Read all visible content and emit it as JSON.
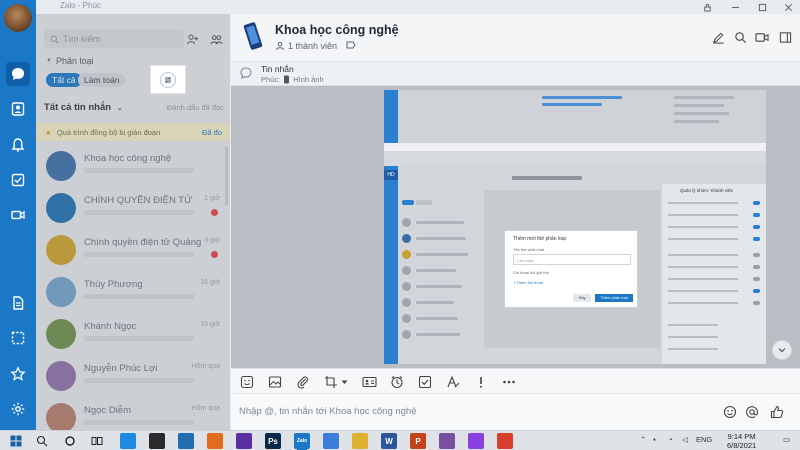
{
  "window": {
    "title": "Zalo - Phúc",
    "controls": [
      "lock-icon",
      "minimize-icon",
      "maximize-icon",
      "close-icon"
    ]
  },
  "sidebar": {
    "items": [
      {
        "name": "messages",
        "icon": "chat-bubble-icon",
        "active": true
      },
      {
        "name": "contacts",
        "icon": "contacts-icon",
        "active": false
      },
      {
        "name": "notifications",
        "icon": "bell-icon",
        "active": false
      },
      {
        "name": "todo",
        "icon": "checkbox-icon",
        "active": false
      },
      {
        "name": "video",
        "icon": "video-icon",
        "active": false
      },
      {
        "name": "files",
        "icon": "document-icon",
        "active": false
      },
      {
        "name": "screenshot",
        "icon": "screenshot-icon",
        "active": false
      },
      {
        "name": "starred",
        "icon": "star-icon",
        "active": false
      },
      {
        "name": "settings",
        "icon": "gear-icon",
        "active": false
      }
    ]
  },
  "conversation_list": {
    "search_placeholder": "Tìm kiếm",
    "category_label": "Phân loại",
    "chips": [
      "Tất cả",
      "Làm toán"
    ],
    "section_title": "Tất cả tin nhắn",
    "section_right": "Đánh dấu đã đọc",
    "sync_text": "Quá trình đồng bộ bị gián đoạn",
    "sync_action": "Đã đo",
    "items": [
      {
        "name": "Khoa học công nghệ",
        "time": "",
        "unread": false,
        "avatar_color": "#3a6ea8"
      },
      {
        "name": "CHÍNH QUYỀN ĐIỆN TỬ",
        "time": "1 giờ",
        "unread": true,
        "avatar_color": "#1f6fb0"
      },
      {
        "name": "Chính quyền điện tử Quảng",
        "time": "3 giờ",
        "unread": true,
        "avatar_color": "#c8a030"
      },
      {
        "name": "Thùy Phương",
        "time": "16 giờ",
        "unread": false,
        "avatar_color": "#6fa0c8"
      },
      {
        "name": "Khánh Ngọc",
        "time": "16 giờ",
        "unread": false,
        "avatar_color": "#6b8e4e"
      },
      {
        "name": "Nguyễn Phúc Lợi",
        "time": "Hôm qua",
        "unread": false,
        "avatar_color": "#8a6fa8"
      },
      {
        "name": "Ngọc Diễm",
        "time": "Hôm qua",
        "unread": false,
        "avatar_color": "#b07a6a"
      }
    ]
  },
  "chat": {
    "name": "Khoa học công nghệ",
    "members": "1 thành viên",
    "pinned_title": "Tin nhắn",
    "pinned_sender": "Phúc:",
    "pinned_text": "Hình ảnh",
    "embedded_dialog": {
      "title": "Thêm mới thẻ phân loại",
      "field_label": "Tên thẻ phân loại",
      "field_value": "Làm toán",
      "list_label": "Chi thoại hội gửi thẻ",
      "add_label": "+ Thêm hội thoại",
      "cancel": "Hủy",
      "confirm": "Thêm phân loại"
    },
    "embedded_panel_title": "Quản lý nhóm: Khánh viên"
  },
  "composer": {
    "placeholder": "Nhập @, tin nhắn tới Khoa học công nghệ",
    "tools": [
      "sticker-icon",
      "image-icon",
      "attachment-icon",
      "screenshot-icon",
      "contact-card-icon",
      "reminder-icon",
      "task-icon",
      "text-format-icon",
      "important-icon",
      "more-icon"
    ]
  },
  "taskbar": {
    "apps": [
      {
        "name": "chrome-edge",
        "color": "#1f8be0",
        "label": ""
      },
      {
        "name": "store",
        "color": "#2b2b2b",
        "label": ""
      },
      {
        "name": "mail",
        "color": "#1f6fb0",
        "label": ""
      },
      {
        "name": "firefox",
        "color": "#e36b1c",
        "label": ""
      },
      {
        "name": "paint",
        "color": "#5a2fa0",
        "label": ""
      },
      {
        "name": "photoshop",
        "color": "#0b2a4a",
        "label": "Ps"
      },
      {
        "name": "zalo",
        "color": "#1b78c6",
        "label": "Zalo"
      },
      {
        "name": "photos",
        "color": "#3b7dd8",
        "label": ""
      },
      {
        "name": "folder",
        "color": "#e0b030",
        "label": ""
      },
      {
        "name": "word",
        "color": "#2b579a",
        "label": "W"
      },
      {
        "name": "powerpoint",
        "color": "#c4431b",
        "label": "P"
      },
      {
        "name": "snip",
        "color": "#7a4fa0",
        "label": ""
      },
      {
        "name": "messenger",
        "color": "#8a3fe0",
        "label": ""
      },
      {
        "name": "chrome",
        "color": "#d8402e",
        "label": ""
      }
    ],
    "language": "ENG",
    "time": "9:14 PM",
    "date": "6/8/2021"
  }
}
